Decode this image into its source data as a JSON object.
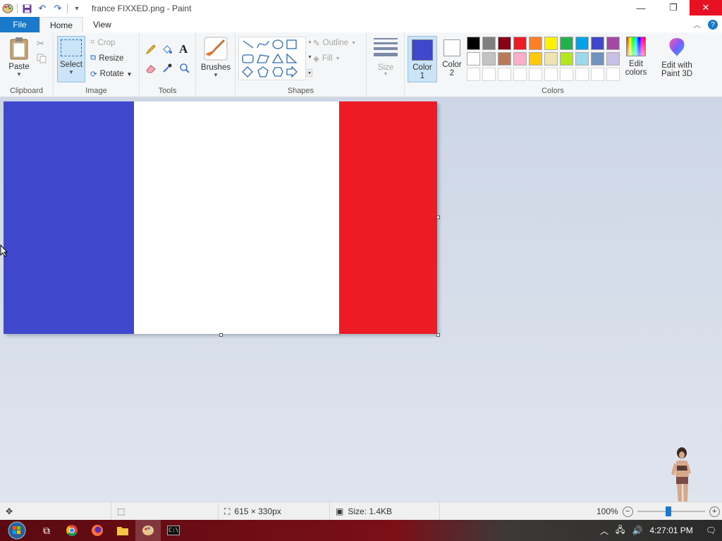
{
  "window": {
    "title": "france FIXXED.png - Paint",
    "minimize_glyph": "—",
    "restore_glyph": "❐",
    "close_glyph": "✕"
  },
  "tabs": [
    {
      "label": "File"
    },
    {
      "label": "Home"
    },
    {
      "label": "View"
    }
  ],
  "clipboard": {
    "paste": "Paste",
    "group": "Clipboard"
  },
  "image": {
    "select": "Select",
    "crop": "Crop",
    "resize": "Resize",
    "rotate": "Rotate",
    "group": "Image"
  },
  "tools": {
    "group": "Tools"
  },
  "brushes": {
    "label": "Brushes"
  },
  "shapes": {
    "outline": "Outline",
    "fill": "Fill",
    "group": "Shapes"
  },
  "size": {
    "label": "Size"
  },
  "colors": {
    "color1": "Color 1",
    "color1_num": "1",
    "color1_word": "Color",
    "color2_word": "Color",
    "color2_num": "2",
    "edit_colors_1": "Edit",
    "edit_colors_2": "colors",
    "paint3d_1": "Edit with",
    "paint3d_2": "Paint 3D",
    "group": "Colors",
    "color1_value": "#3f48cc",
    "color2_value": "#ffffff",
    "palette_row1": [
      "#000000",
      "#7f7f7f",
      "#880015",
      "#ed1c24",
      "#ff7f27",
      "#fff200",
      "#22b14c",
      "#00a2e8",
      "#3f48cc",
      "#a349a4"
    ],
    "palette_row2": [
      "#ffffff",
      "#c3c3c3",
      "#b97a57",
      "#ffaec9",
      "#ffc90e",
      "#efe4b0",
      "#b5e61d",
      "#99d9ea",
      "#7092be",
      "#c8bfe7"
    ]
  },
  "canvas_image": {
    "stripe_colors": [
      "#3f48cc",
      "#ffffff",
      "#ed1c24"
    ]
  },
  "status": {
    "dimensions": "615 × 330px",
    "size": "Size: 1.4KB",
    "zoom": "100%"
  },
  "taskbar": {
    "time": "4:27:01 PM"
  }
}
